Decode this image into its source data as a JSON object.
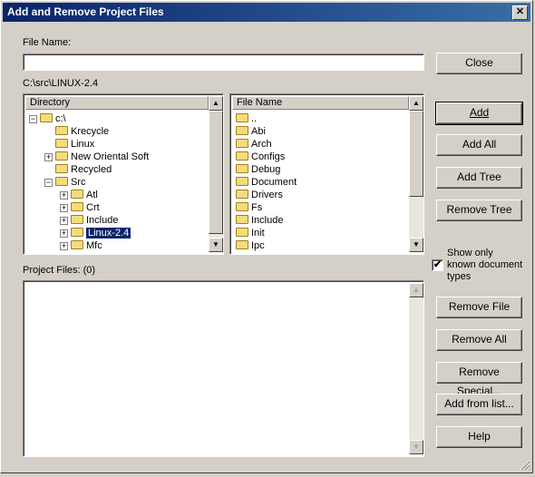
{
  "window": {
    "title": "Add and Remove Project Files",
    "close_glyph": "✕"
  },
  "file_name": {
    "label": "File Name:",
    "value": ""
  },
  "current_path": "C:\\src\\LINUX-2.4",
  "directory": {
    "header": "Directory",
    "items": [
      {
        "label": "c:\\",
        "pm": "−"
      },
      {
        "label": "Krecycle",
        "pm": ""
      },
      {
        "label": "Linux",
        "pm": ""
      },
      {
        "label": "New Oriental Soft",
        "pm": "+"
      },
      {
        "label": "Recycled",
        "pm": ""
      },
      {
        "label": "Src",
        "pm": "−"
      },
      {
        "label": "Atl",
        "pm": "+"
      },
      {
        "label": "Crt",
        "pm": "+"
      },
      {
        "label": "Include",
        "pm": "+"
      },
      {
        "label": "Linux-2.4",
        "pm": "+"
      },
      {
        "label": "Mfc",
        "pm": "+"
      }
    ],
    "selected": "Linux-2.4"
  },
  "files": {
    "header": "File Name",
    "items": [
      "..",
      "Abi",
      "Arch",
      "Configs",
      "Debug",
      "Document",
      "Drivers",
      "Fs",
      "Include",
      "Init",
      "Ipc"
    ]
  },
  "project_files": {
    "label": "Project Files: (0)",
    "items": []
  },
  "checkbox": {
    "label_line1": "Show only",
    "label_line2": "known document",
    "label_line3": "types",
    "checked": "✔"
  },
  "buttons": {
    "close": "Close",
    "add": "Add",
    "add_all": "Add All",
    "add_tree": "Add Tree",
    "remove_tree": "Remove Tree",
    "remove_file": "Remove File",
    "remove_all": "Remove All",
    "remove_special": "Remove Special...",
    "add_from_list": "Add from list...",
    "help": "Help"
  },
  "scroll_glyphs": {
    "up": "▲",
    "down": "▼"
  }
}
